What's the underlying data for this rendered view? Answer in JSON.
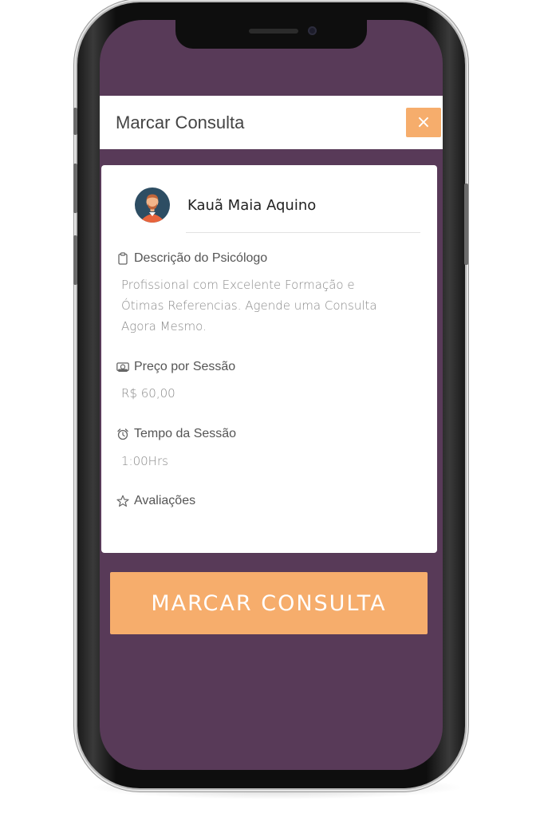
{
  "modal": {
    "title": "Marcar Consulta",
    "close_label": "×"
  },
  "psychologist": {
    "name": "Kauã Maia Aquino",
    "description_label": "Descrição do Psicólogo",
    "description": "Profissional com Excelente Formação e Ótimas Referencias. Agende uma Consulta Agora Mesmo.",
    "price_label": "Preço por Sessão",
    "price": "R$ 60,00",
    "duration_label": "Tempo da Sessão",
    "duration": "1:00Hrs",
    "ratings_label": "Avaliações"
  },
  "cta": {
    "label": "MARCAR CONSULTA"
  },
  "icons": {
    "avatar": "avatar-icon",
    "description": "clipboard-icon",
    "price": "money-icon",
    "duration": "alarm-clock-icon",
    "ratings": "star-icon"
  },
  "colors": {
    "background": "#583a58",
    "accent": "#f6ad6c"
  }
}
